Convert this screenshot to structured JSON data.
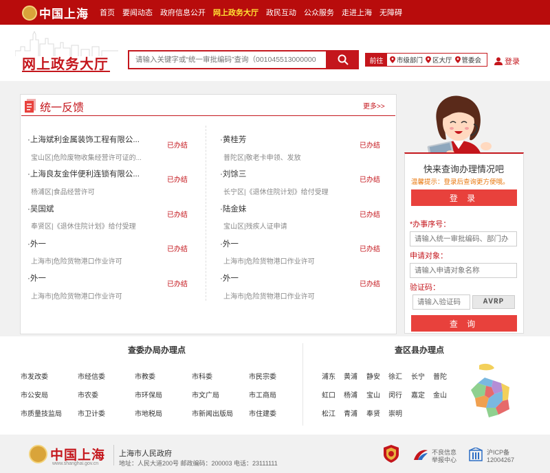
{
  "site": {
    "name": "中国上海"
  },
  "nav": [
    "首页",
    "要闻动态",
    "政府信息公开",
    "网上政务大厅",
    "政民互动",
    "公众服务",
    "走进上海",
    "无障碍"
  ],
  "nav_active_index": 3,
  "header": {
    "title": "网上政务大厅",
    "search_placeholder": "请输入关键字或“统一审批编码”查询（001045513000000",
    "goto_label": "前往",
    "goto_links": [
      "市级部门",
      "区大厅",
      "管委会"
    ],
    "login": "登录"
  },
  "feedback": {
    "title": "统一反馈",
    "more": "更多>>",
    "left": [
      {
        "name": "·上海斌利金属装饰工程有限公...",
        "sub": "宝山区|危险废物收集经营许可证的...",
        "status": "已办结"
      },
      {
        "name": "·上海良友金伴便利连锁有限公...",
        "sub": "杨浦区|食品经营许可",
        "status": "已办结"
      },
      {
        "name": "·吴国斌",
        "sub": "奉贤区|《退休住院计划》给付受理",
        "status": "已办结"
      },
      {
        "name": "·外一",
        "sub": "上海市|危险货物港口作业许可",
        "status": "已办结"
      },
      {
        "name": "·外一",
        "sub": "上海市|危险货物港口作业许可",
        "status": "已办结"
      }
    ],
    "right": [
      {
        "name": "·黄桂芳",
        "sub": "普陀区|敬老卡申领、发放",
        "status": "已办结"
      },
      {
        "name": "·刘馀三",
        "sub": "长宁区|《退休住院计划》给付受理",
        "status": "已办结"
      },
      {
        "name": "·陆金妹",
        "sub": "宝山区|残疾人证申请",
        "status": "已办结"
      },
      {
        "name": "·外一",
        "sub": "上海市|危险货物港口作业许可",
        "status": "已办结"
      },
      {
        "name": "·外一",
        "sub": "上海市|危险货物港口作业许可",
        "status": "已办结"
      }
    ]
  },
  "quick": {
    "title": "快来查询办理情况吧",
    "hint": "温馨提示：登录后查询更方便哦。",
    "login_btn": "登 录",
    "field1_label": "*办事序号：",
    "field1_placeholder": "请输入统一审批编码、部门办",
    "field2_label": "申请对象：",
    "field2_placeholder": "请输入申请对象名称",
    "field3_label": "验证码：",
    "field3_placeholder": "请输入验证码",
    "captcha": "AVRP",
    "query_btn": "查 询"
  },
  "departments": {
    "title": "查委办局办理点",
    "rows": [
      [
        "市发改委",
        "市经信委",
        "市教委",
        "市科委",
        "市民宗委"
      ],
      [
        "市公安局",
        "市农委",
        "市环保局",
        "市文广局",
        "市工商局"
      ],
      [
        "市质量技监局",
        "市卫计委",
        "市地税局",
        "市新闻出版局",
        "市住建委"
      ]
    ]
  },
  "districts": {
    "title": "查区县办理点",
    "rows": [
      [
        "浦东",
        "黄浦",
        "静安",
        "徐汇",
        "长宁",
        "普陀"
      ],
      [
        "虹口",
        "杨浦",
        "宝山",
        "闵行",
        "嘉定",
        "金山"
      ],
      [
        "松江",
        "青浦",
        "奉贤",
        "崇明"
      ]
    ]
  },
  "footer": {
    "logo": "中国上海",
    "url": "www.shanghai.gov.cn",
    "name": "上海市人民政府",
    "address": "地址：人民大道200号    邮政编码：200003    电话：23111111",
    "report_l1": "不良信息",
    "report_l2": "举报中心",
    "icp_l1": "沪ICP备",
    "icp_l2": "12004267"
  },
  "colors": {
    "brand_red": "#c4161c",
    "nav_active": "#ffe033",
    "button_red": "#e8413c",
    "hint_orange": "#e8770c"
  }
}
